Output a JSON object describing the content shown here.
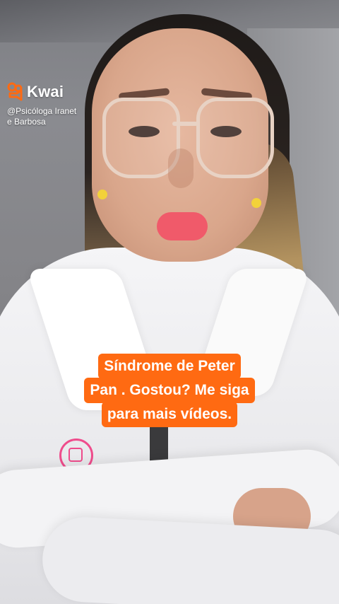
{
  "watermark": {
    "brand": "Kwai",
    "handle_line1": "@Psicóloga Iranet",
    "handle_line2": "e Barbosa",
    "icon": "kwai-logo-icon",
    "brand_color": "#ff6a12"
  },
  "caption": {
    "lines": [
      "Síndrome de Peter",
      "Pan . Gostou? Me siga",
      "para mais vídeos."
    ],
    "background_color": "#ff6a12",
    "text_color": "#ffffff"
  }
}
